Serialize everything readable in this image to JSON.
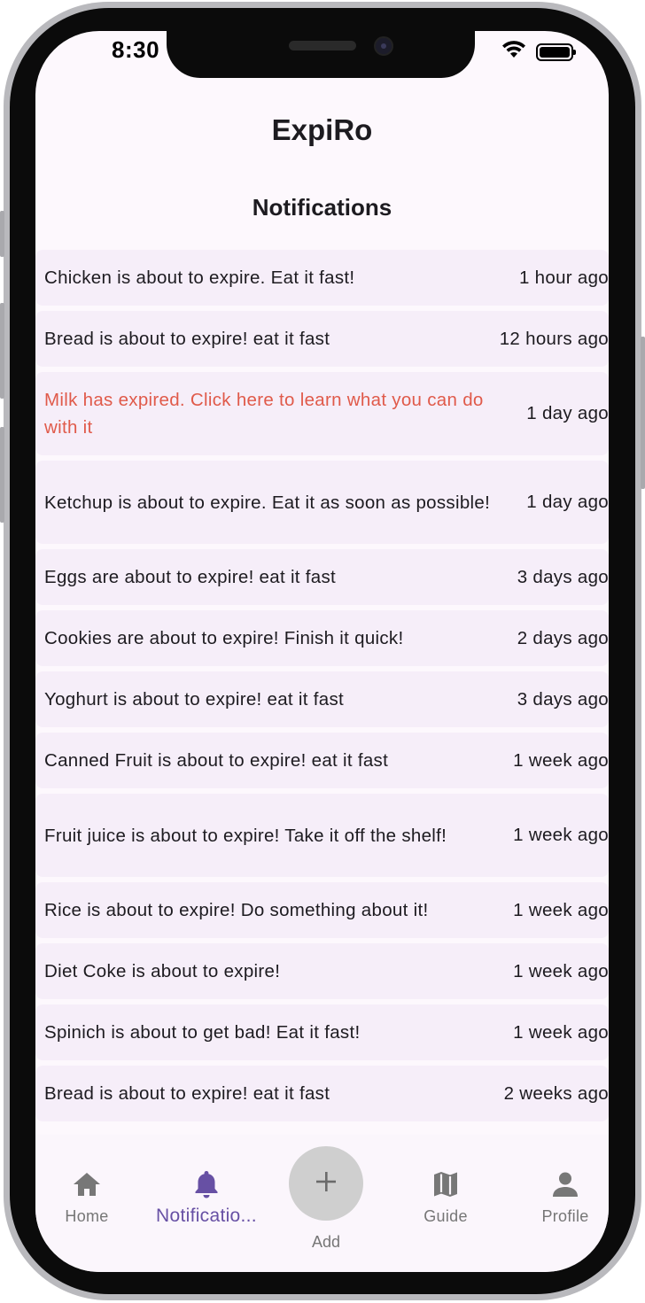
{
  "status_bar": {
    "time": "8:30"
  },
  "app": {
    "title": "ExpiRo"
  },
  "page": {
    "title": "Notifications"
  },
  "notifications": [
    {
      "message": "Chicken is about to expire. Eat it fast!",
      "time": "1 hour ago",
      "alert": false
    },
    {
      "message": "Bread is about to expire! eat it fast",
      "time": "12 hours ago",
      "alert": false
    },
    {
      "message": "Milk has expired. Click here to learn what you can do with it",
      "time": "1 day ago",
      "alert": true
    },
    {
      "message": "Ketchup is about to expire. Eat it as soon as possible!",
      "time": "1 day ago",
      "alert": false
    },
    {
      "message": "Eggs are about to expire! eat it fast",
      "time": "3 days ago",
      "alert": false
    },
    {
      "message": "Cookies are about to expire! Finish it quick!",
      "time": "2 days ago",
      "alert": false
    },
    {
      "message": "Yoghurt is about to expire! eat it fast",
      "time": "3 days ago",
      "alert": false
    },
    {
      "message": "Canned Fruit is about to expire! eat it fast",
      "time": "1 week ago",
      "alert": false
    },
    {
      "message": "Fruit juice is about to expire! Take it off the shelf!",
      "time": "1 week ago",
      "alert": false
    },
    {
      "message": "Rice is about to expire! Do something about it!",
      "time": "1 week ago",
      "alert": false
    },
    {
      "message": "Diet Coke is about to expire!",
      "time": "1 week ago",
      "alert": false
    },
    {
      "message": "Spinich is about to get bad! Eat it fast!",
      "time": "1 week ago",
      "alert": false
    },
    {
      "message": "Bread is about to expire! eat it fast",
      "time": "2 weeks ago",
      "alert": false
    }
  ],
  "bottom_nav": {
    "items": [
      {
        "label": "Home",
        "icon": "home-icon",
        "active": false
      },
      {
        "label": "Notificatio...",
        "icon": "bell-icon",
        "active": true
      },
      {
        "label": "Guide",
        "icon": "map-icon",
        "active": false
      },
      {
        "label": "Profile",
        "icon": "person-icon",
        "active": false
      }
    ],
    "add_label": "Add",
    "add_icon": "plus-icon"
  },
  "colors": {
    "accent": "#6750a4",
    "alert_text": "#e05a4a",
    "row_background": "#f6eef9",
    "screen_background": "#fdf8fd"
  }
}
